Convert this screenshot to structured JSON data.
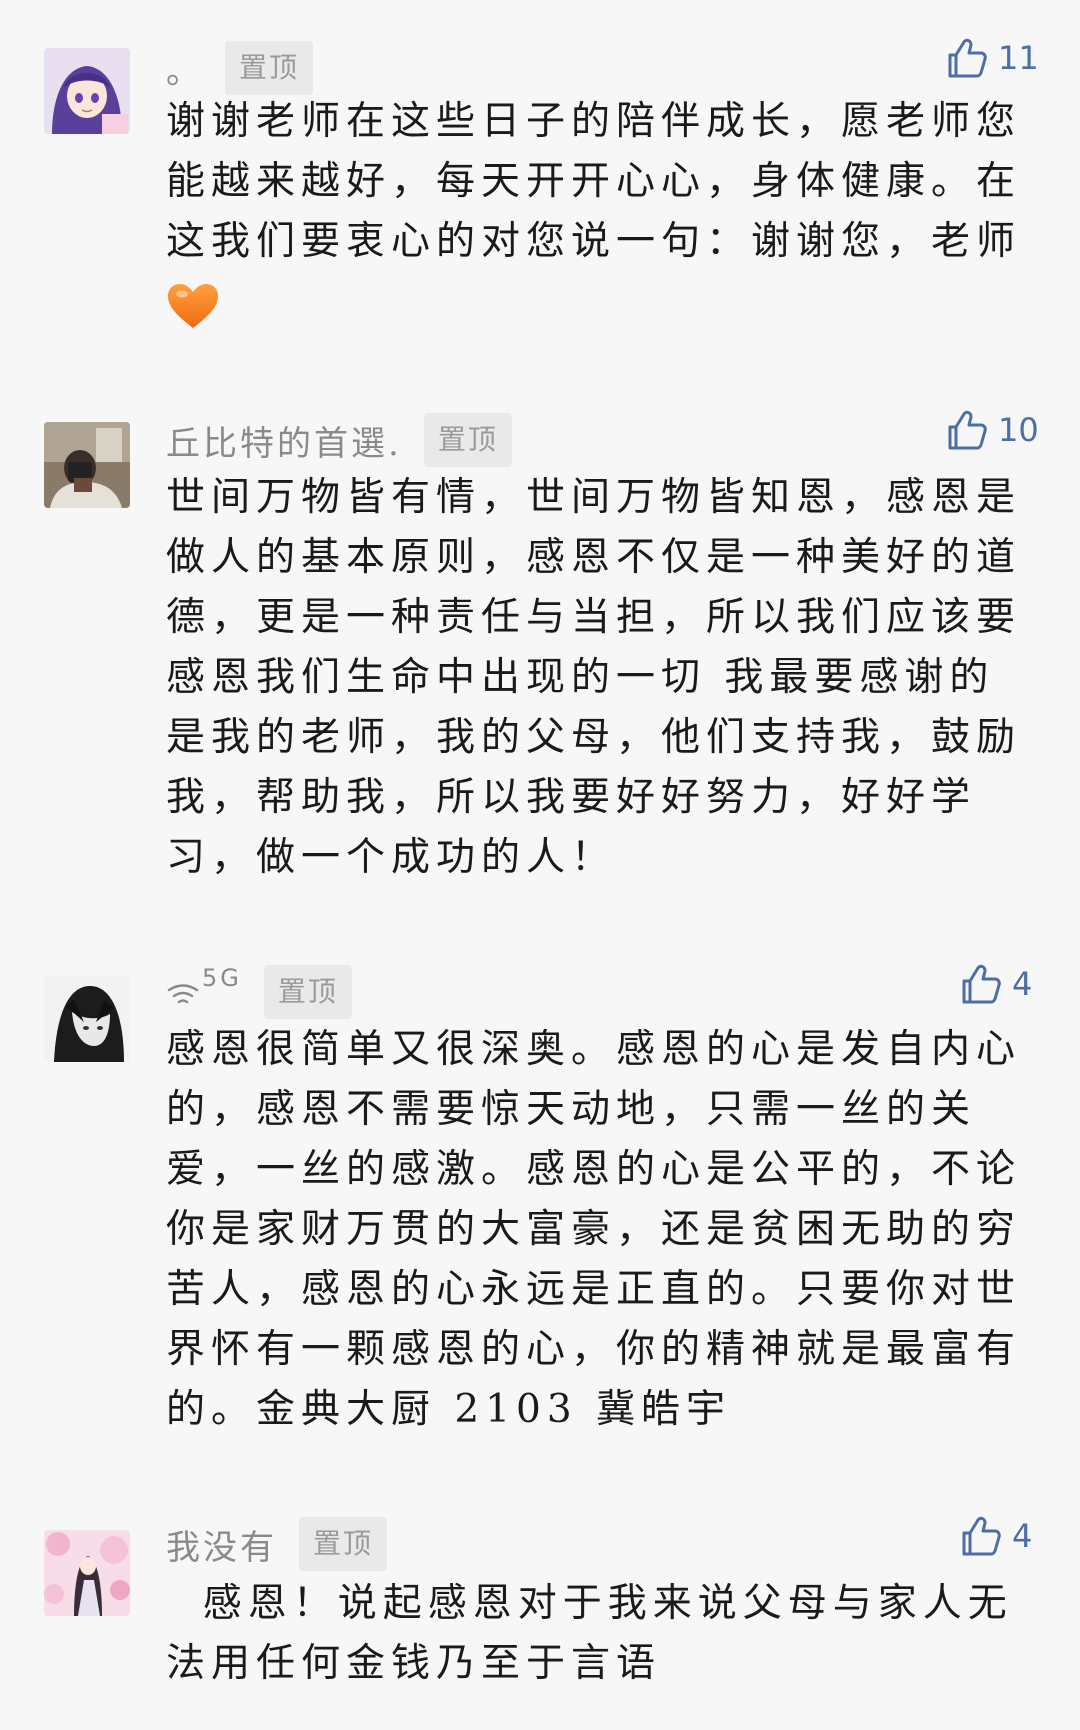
{
  "comments": [
    {
      "nickname": "。",
      "pinned_label": "置顶",
      "likes": "11",
      "avatar_icon": "anime-girl-avatar",
      "text": "谢谢老师在这些日子的陪伴成长，愿老师您能越来越好，每天开开心心，身体健康。在这我们要衷心的对您说一句：谢谢您，老师",
      "emoji": "orange-heart-icon"
    },
    {
      "nickname": "丘比特的首選.",
      "pinned_label": "置顶",
      "likes": "10",
      "avatar_icon": "photo-avatar",
      "text": "世间万物皆有情，世间万物皆知恩，感恩是做人的基本原则，感恩不仅是一种美好的道德，更是一种责任与当担，所以我们应该要感恩我们生命中出现的一切 我最要感谢的是我的老师，我的父母，他们支持我，鼓励我，帮助我，所以我要好好努力，好好学习，做一个成功的人！"
    },
    {
      "nickname": "5G",
      "nickname_icon": "wifi-icon",
      "pinned_label": "置顶",
      "likes": "4",
      "avatar_icon": "monochrome-anime-avatar",
      "text": "感恩很简单又很深奥。感恩的心是发自内心的，感恩不需要惊天动地，只需一丝的关爱，一丝的感激。感恩的心是公平的，不论你是家财万贯的大富豪，还是贫困无助的穷苦人，感恩的心永远是正直的。只要你对世界怀有一颗感恩的心，你的精神就是最富有的。金典大厨 2103 冀皓宇"
    },
    {
      "nickname": "我没有",
      "pinned_label": "置顶",
      "likes": "4",
      "avatar_icon": "cherry-blossom-avatar",
      "text": "  感恩！说起感恩对于我来说父母与家人无法用任何金钱乃至于言语"
    }
  ],
  "colors": {
    "background": "#f7f7f7",
    "like_blue": "#4c6ea8",
    "nickname_gray": "#8a8a8a",
    "pinned_bg": "#e9e9e9"
  }
}
